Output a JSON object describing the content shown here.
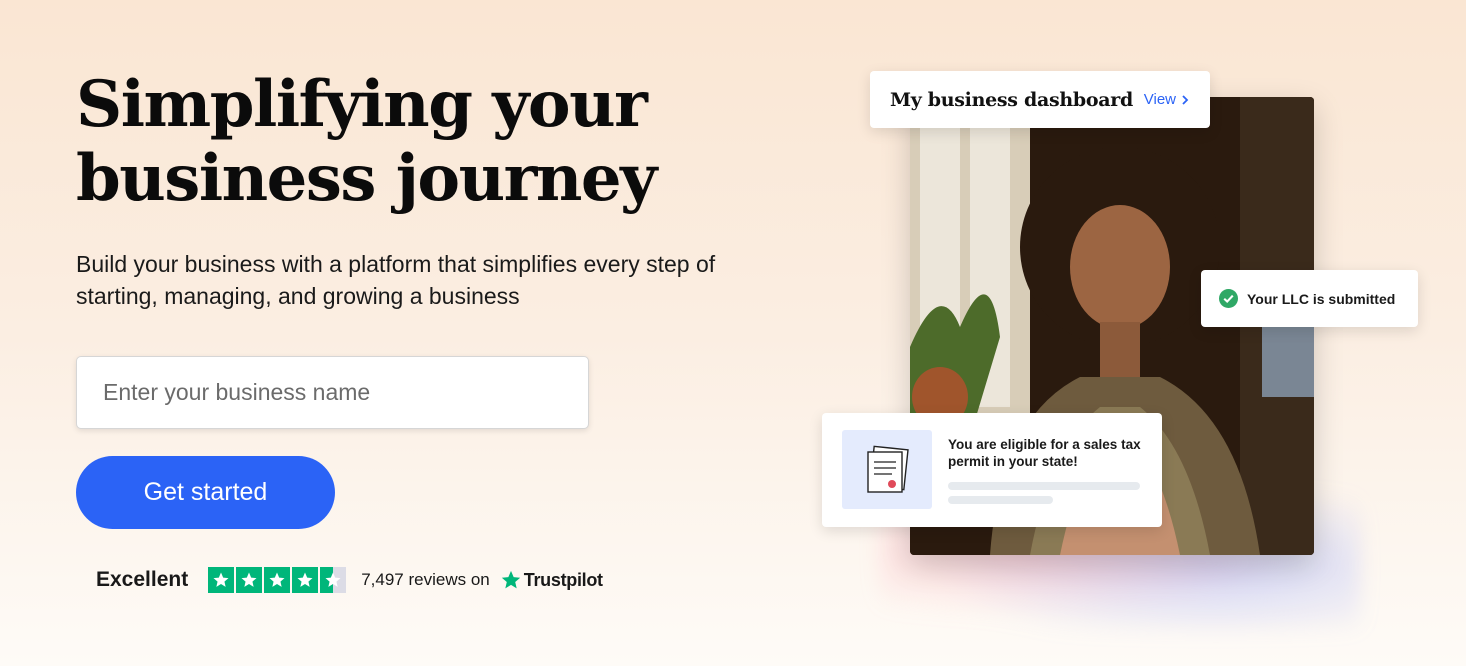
{
  "hero": {
    "headline_line1": "Simplifying your",
    "headline_line2": "business journey",
    "subhead": "Build your business with a platform that simplifies every step of starting, managing, and growing a business",
    "input_placeholder": "Enter your business name",
    "input_value": "",
    "cta_label": "Get started"
  },
  "rating": {
    "label": "Excellent",
    "stars": 4.5,
    "reviews_text": "7,497 reviews on",
    "brand": "Trustpilot",
    "star_color": "#00b67a"
  },
  "illustration": {
    "dashboard_title": "My business dashboard",
    "dashboard_link": "View",
    "llc_status": "Your LLC is submitted",
    "tax_message": "You are eligible for a sales tax permit in your state!"
  },
  "colors": {
    "accent": "#2b63f6",
    "success": "#2fa866",
    "background_top": "#fae6d3",
    "doc_box": "#e4ebfd"
  },
  "icons": {
    "view": "chevron-right-icon",
    "llc": "check-circle-icon",
    "tax": "document-icon",
    "trustpilot": "star-icon"
  }
}
